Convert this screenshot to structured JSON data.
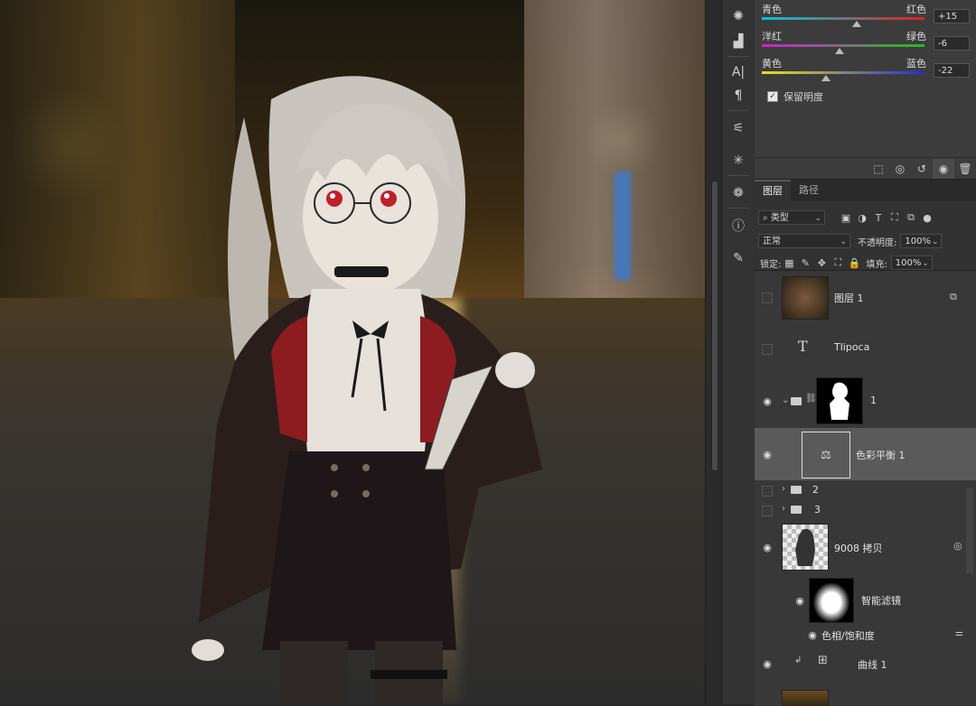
{
  "properties": {
    "sliders": [
      {
        "left": "青色",
        "right": "红色",
        "value": "+15",
        "pos": 0.575,
        "gradient": [
          "#00c8d8",
          "#e02020"
        ]
      },
      {
        "left": "洋红",
        "right": "绿色",
        "value": "-6",
        "pos": 0.47,
        "gradient": [
          "#d020d0",
          "#20c020"
        ]
      },
      {
        "left": "黄色",
        "right": "蓝色",
        "value": "-22",
        "pos": 0.39,
        "gradient": [
          "#e8e020",
          "#2030d8"
        ]
      }
    ],
    "preserve_luminosity": {
      "label": "保留明度",
      "checked": true
    }
  },
  "tabs": [
    "图层",
    "路径"
  ],
  "layers_panel": {
    "filter_kind": "类型",
    "blend_mode": "正常",
    "opacity_label": "不透明度:",
    "opacity_value": "100%",
    "lock_label": "锁定:",
    "fill_label": "填充:",
    "fill_value": "100%"
  },
  "layers": [
    {
      "name": "图层 1",
      "visible": false,
      "kind": "pixel"
    },
    {
      "name": "Tlipoca",
      "visible": false,
      "kind": "text"
    },
    {
      "name": "1",
      "visible": true,
      "kind": "group-mask"
    },
    {
      "name": "色彩平衡 1",
      "visible": true,
      "kind": "adjustment",
      "selected": true
    },
    {
      "name": "2",
      "visible": false,
      "kind": "group"
    },
    {
      "name": "3",
      "visible": false,
      "kind": "group"
    },
    {
      "name": "9008 拷贝",
      "visible": true,
      "kind": "smart"
    },
    {
      "name": "智能滤镜",
      "visible": true,
      "kind": "smart-filter"
    },
    {
      "name": "色相/饱和度",
      "visible": true,
      "kind": "filter-item"
    },
    {
      "name": "曲线 1",
      "visible": true,
      "kind": "curves"
    }
  ],
  "icons": {
    "text_layer": "T",
    "folder": "folder-icon",
    "eye": "eye-icon"
  }
}
